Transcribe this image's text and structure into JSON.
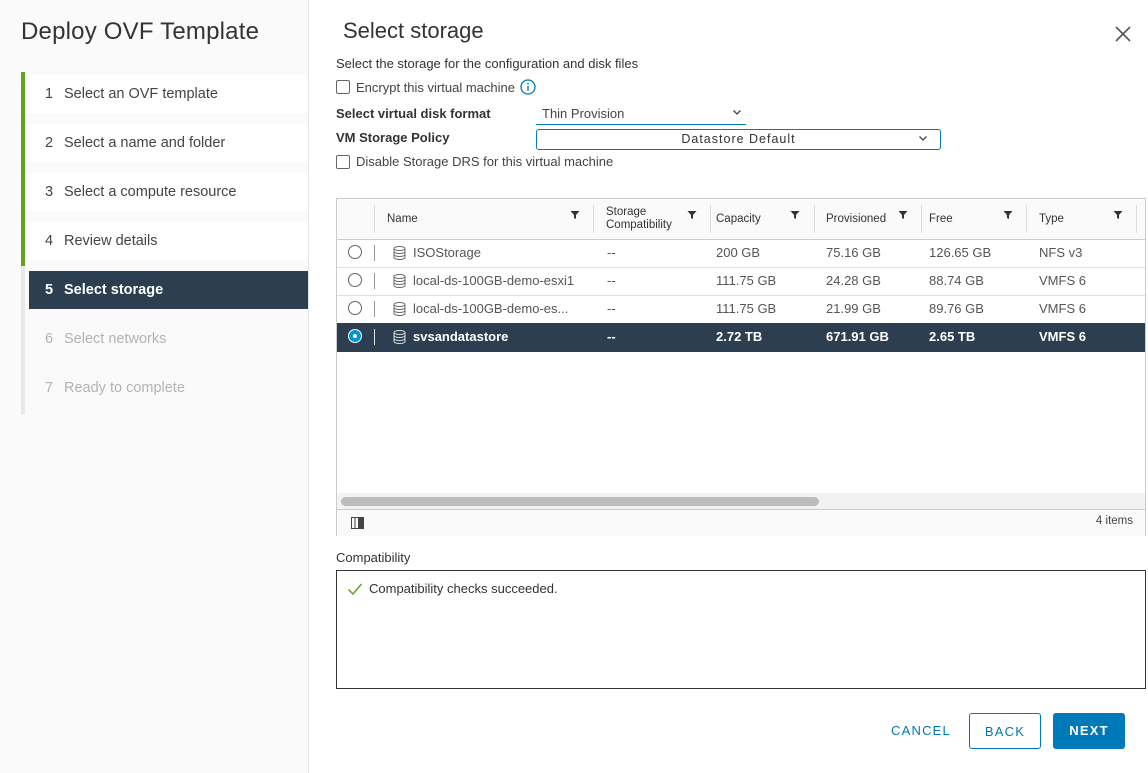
{
  "wizard": {
    "title": "Deploy OVF Template",
    "steps": [
      {
        "num": "1",
        "label": "Select an OVF template",
        "state": "done"
      },
      {
        "num": "2",
        "label": "Select a name and folder",
        "state": "done"
      },
      {
        "num": "3",
        "label": "Select a compute resource",
        "state": "done"
      },
      {
        "num": "4",
        "label": "Review details",
        "state": "done"
      },
      {
        "num": "5",
        "label": "Select storage",
        "state": "current"
      },
      {
        "num": "6",
        "label": "Select networks",
        "state": "pending"
      },
      {
        "num": "7",
        "label": "Ready to complete",
        "state": "pending"
      }
    ]
  },
  "page": {
    "title": "Select storage",
    "subtitle": "Select the storage for the configuration and disk files",
    "encrypt_label": "Encrypt this virtual machine",
    "disk_format_label": "Select virtual disk format",
    "disk_format_value": "Thin Provision",
    "policy_label": "VM Storage Policy",
    "policy_value": "Datastore Default",
    "disable_drs_label": "Disable Storage DRS for this virtual machine"
  },
  "grid": {
    "columns": {
      "name": "Name",
      "storage_compat_1": "Storage",
      "storage_compat_2": "Compatibility",
      "capacity": "Capacity",
      "provisioned": "Provisioned",
      "free": "Free",
      "type": "Type"
    },
    "rows": [
      {
        "name": "ISOStorage",
        "compat": "--",
        "capacity": "200 GB",
        "provisioned": "75.16 GB",
        "free": "126.65 GB",
        "type": "NFS v3",
        "selected": false
      },
      {
        "name": "local-ds-100GB-demo-esxi1",
        "compat": "--",
        "capacity": "111.75 GB",
        "provisioned": "24.28 GB",
        "free": "88.74 GB",
        "type": "VMFS 6",
        "selected": false
      },
      {
        "name": "local-ds-100GB-demo-es...",
        "compat": "--",
        "capacity": "111.75 GB",
        "provisioned": "21.99 GB",
        "free": "89.76 GB",
        "type": "VMFS 6",
        "selected": false
      },
      {
        "name": "svsandatastore",
        "compat": "--",
        "capacity": "2.72 TB",
        "provisioned": "671.91 GB",
        "free": "2.65 TB",
        "type": "VMFS 6",
        "selected": true
      }
    ],
    "item_count": "4 items"
  },
  "compatibility": {
    "label": "Compatibility",
    "message": "Compatibility checks succeeded."
  },
  "buttons": {
    "cancel": "CANCEL",
    "back": "BACK",
    "next": "NEXT"
  },
  "colors": {
    "accent": "#0079b8",
    "selected_row": "#2c3e50",
    "done_rail": "#62a420",
    "success": "#62a420"
  }
}
